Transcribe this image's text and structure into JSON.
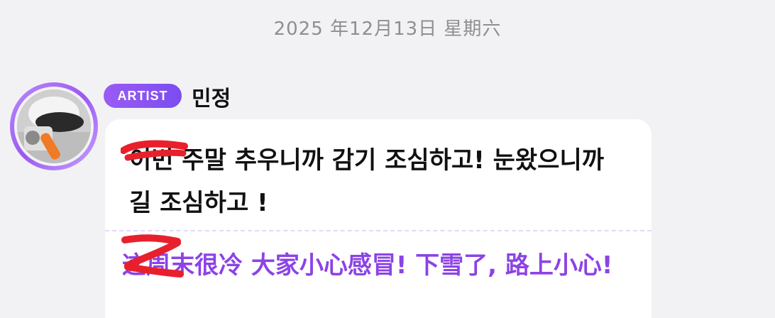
{
  "date_header": "2025 年12月13日 星期六",
  "sender": {
    "badge": "ARTIST",
    "name": "민정"
  },
  "message": {
    "korean": "이번 주말 추우니까 감기 조심하고! 눈왔으니까 길 조심하고 !",
    "chinese": "这周末很冷 大家小心感冒! 下雪了, 路上小心!"
  },
  "colors": {
    "accent": "#8b43e6",
    "badge": "#7b4cf0",
    "redaction": "#e8202c"
  },
  "icons": {
    "avatar": "artist-avatar-photo"
  }
}
